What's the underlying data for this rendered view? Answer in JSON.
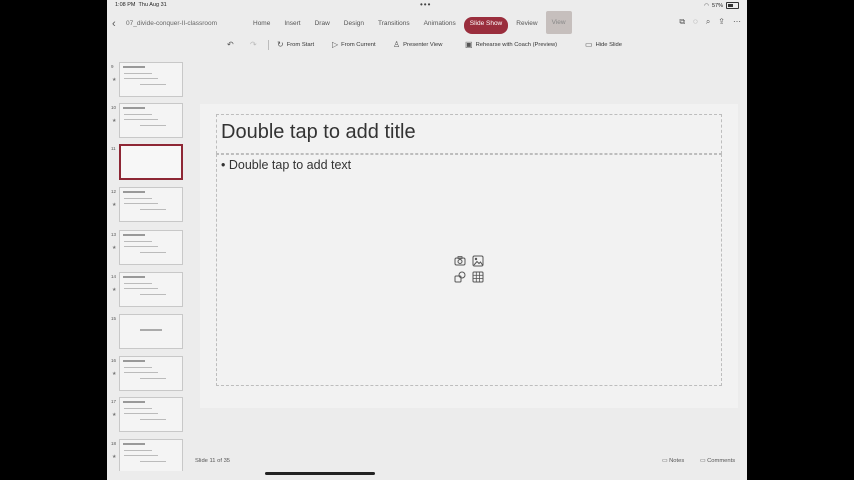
{
  "status": {
    "time": "1:08 PM",
    "date": "Thu Aug 31",
    "battery": "57%"
  },
  "document": {
    "title": "07_divide-conquer-II-classroom"
  },
  "ribbon": {
    "tabs": [
      {
        "label": "Home"
      },
      {
        "label": "Insert"
      },
      {
        "label": "Draw"
      },
      {
        "label": "Design"
      },
      {
        "label": "Transitions"
      },
      {
        "label": "Animations"
      },
      {
        "label": "Slide Show"
      },
      {
        "label": "Review"
      },
      {
        "label": "View"
      }
    ],
    "active_tab": "Slide Show"
  },
  "toolbar": {
    "from_start": "From Start",
    "from_current": "From Current",
    "presenter_view": "Presenter View",
    "rehearse": "Rehearse with Coach (Preview)",
    "hide_slide": "Hide Slide"
  },
  "thumbnails": [
    {
      "num": "9"
    },
    {
      "num": "10"
    },
    {
      "num": "11"
    },
    {
      "num": "12"
    },
    {
      "num": "13"
    },
    {
      "num": "14"
    },
    {
      "num": "15"
    },
    {
      "num": "16"
    },
    {
      "num": "17"
    },
    {
      "num": "18"
    }
  ],
  "slide": {
    "title_placeholder": "Double tap to add title",
    "body_placeholder": "• Double tap to add text"
  },
  "bottom": {
    "slide_count": "Slide 11 of 35",
    "notes": "Notes",
    "comments": "Comments"
  },
  "colors": {
    "accent": "#9a2e3d",
    "background": "#ececec"
  }
}
